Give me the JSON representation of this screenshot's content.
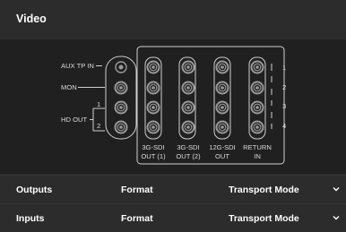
{
  "header": {
    "title": "Video"
  },
  "diagram": {
    "left_labels": {
      "aux_tp_in": "AUX TP IN",
      "mon": "MON",
      "hd_out": "HD OUT",
      "hd_out_1": "1",
      "hd_out_2": "2"
    },
    "right_numbers": [
      "1",
      "2",
      "3",
      "4"
    ],
    "columns": [
      {
        "line1": "3G-SDI",
        "line2": "OUT (1)"
      },
      {
        "line1": "3G-SDI",
        "line2": "OUT (2)"
      },
      {
        "line1": "12G-SDI",
        "line2": "OUT"
      },
      {
        "line1": "RETURN",
        "line2": "IN"
      }
    ]
  },
  "rows": [
    {
      "label": "Outputs",
      "format": "Format",
      "transport": "Transport Mode",
      "icon": "chevron-down-icon"
    },
    {
      "label": "Inputs",
      "format": "Format",
      "transport": "Transport Mode",
      "icon": "chevron-down-icon"
    }
  ],
  "colors": {
    "panel": "#2c2c2c",
    "diagram_bg": "#202020",
    "connector": "#9a9a9a"
  }
}
